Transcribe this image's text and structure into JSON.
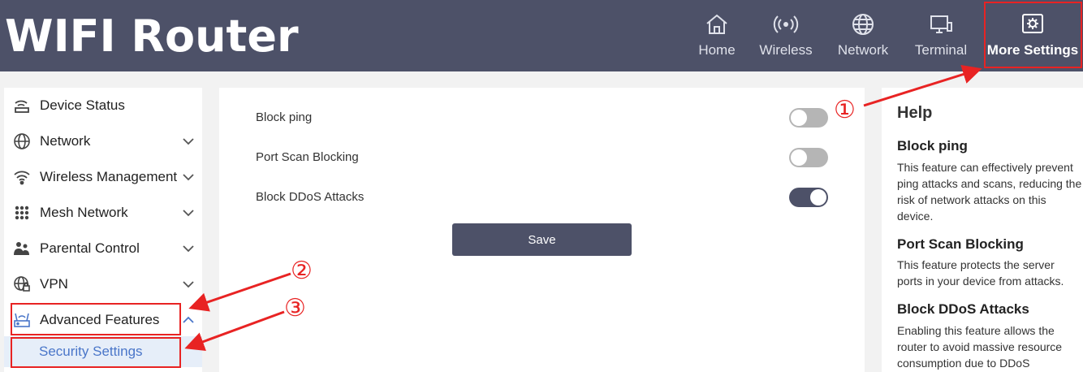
{
  "header": {
    "brand": "WIFI Router",
    "nav": [
      {
        "label": "Home",
        "icon": "home-icon"
      },
      {
        "label": "Wireless",
        "icon": "wireless-icon"
      },
      {
        "label": "Network",
        "icon": "globe-icon"
      },
      {
        "label": "Terminal",
        "icon": "terminal-icon"
      },
      {
        "label": "More Settings",
        "icon": "settings-icon"
      }
    ]
  },
  "sidebar": {
    "items": [
      {
        "label": "Device Status",
        "icon": "device-status-icon"
      },
      {
        "label": "Network",
        "icon": "globe-icon"
      },
      {
        "label": "Wireless Management",
        "icon": "wifi-icon"
      },
      {
        "label": "Mesh Network",
        "icon": "mesh-icon"
      },
      {
        "label": "Parental Control",
        "icon": "parental-icon"
      },
      {
        "label": "VPN",
        "icon": "vpn-icon"
      },
      {
        "label": "Advanced Features",
        "icon": "advanced-icon"
      }
    ],
    "sub_item": "Security Settings"
  },
  "main": {
    "rows": [
      {
        "label": "Block ping",
        "enabled": false
      },
      {
        "label": "Port Scan Blocking",
        "enabled": false
      },
      {
        "label": "Block DDoS Attacks",
        "enabled": true
      }
    ],
    "save_label": "Save"
  },
  "help": {
    "title": "Help",
    "sections": [
      {
        "heading": "Block ping",
        "text": "This feature can effectively prevent ping attacks and scans, reducing the risk of network attacks on this device."
      },
      {
        "heading": "Port Scan Blocking",
        "text": "This feature protects the server ports in your device from attacks."
      },
      {
        "heading": "Block DDoS Attacks",
        "text": "Enabling this feature allows the router to avoid massive resource consumption due to DDoS"
      }
    ]
  },
  "annotations": [
    "①",
    "②",
    "③"
  ],
  "colors": {
    "header": "#4d5168",
    "accent": "#4a76c9",
    "annotation": "#e82323"
  }
}
